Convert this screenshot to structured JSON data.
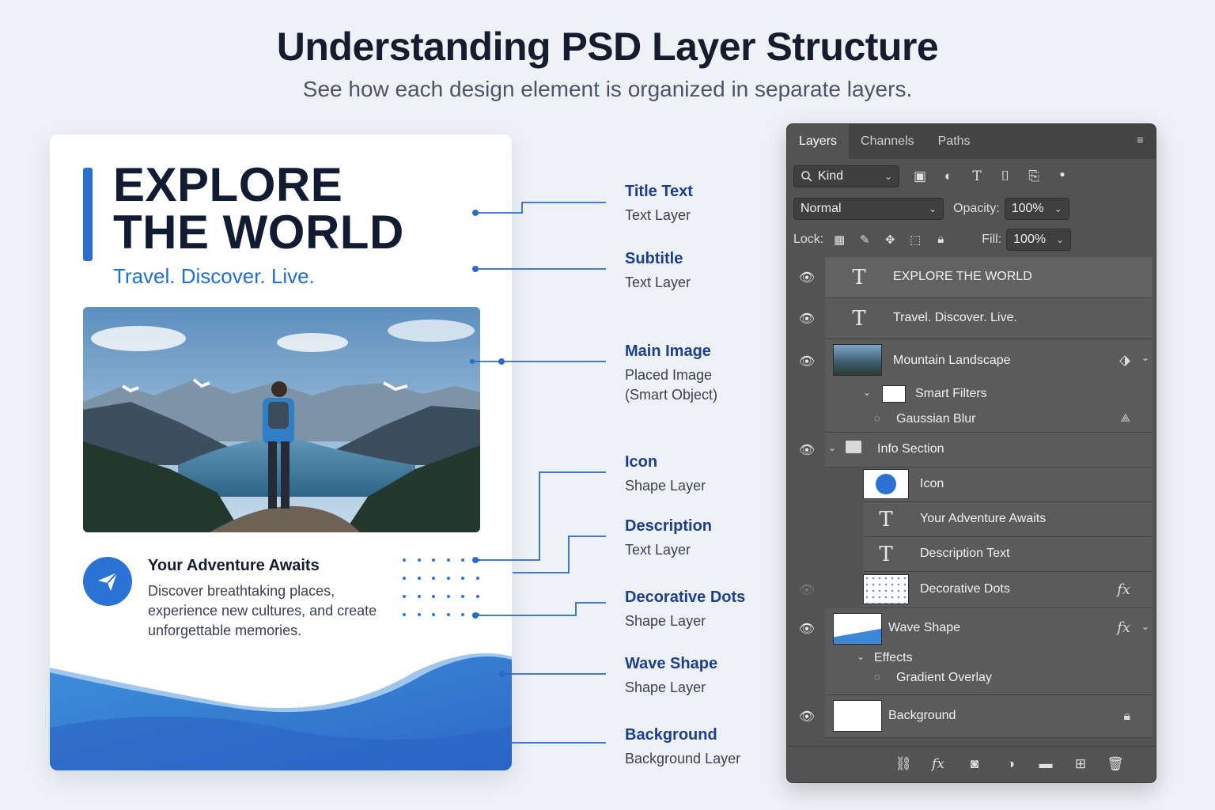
{
  "header": {
    "title": "Understanding PSD Layer Structure",
    "subtitle": "See how each design element is organized in separate layers."
  },
  "poster": {
    "title_line1": "EXPLORE",
    "title_line2": "THE WORLD",
    "subtitle": "Travel. Discover. Live.",
    "info_title": "Your Adventure Awaits",
    "info_desc": "Discover breathtaking places, experience new cultures, and create unforgettable memories."
  },
  "labels": [
    {
      "name": "Title Text",
      "type": "Text Layer"
    },
    {
      "name": "Subtitle",
      "type": "Text Layer"
    },
    {
      "name": "Main Image",
      "type": "Placed Image",
      "type2": "(Smart Object)"
    },
    {
      "name": "Icon",
      "type": "Shape Layer"
    },
    {
      "name": "Description",
      "type": "Text Layer"
    },
    {
      "name": "Decorative Dots",
      "type": "Shape Layer"
    },
    {
      "name": "Wave Shape",
      "type": "Shape Layer"
    },
    {
      "name": "Background",
      "type": "Background Layer"
    }
  ],
  "panel": {
    "tabs": [
      "Layers",
      "Channels",
      "Paths"
    ],
    "filter_label": "Kind",
    "blend_mode": "Normal",
    "opacity_label": "Opacity:",
    "opacity_value": "100%",
    "lock_label": "Lock:",
    "fill_label": "Fill:",
    "fill_value": "100%",
    "layers": {
      "title": "EXPLORE THE WORLD",
      "subtitle": "Travel. Discover. Live.",
      "mountain": "Mountain Landscape",
      "smart_filters": "Smart Filters",
      "gaussian": "Gaussian Blur",
      "info_section": "Info Section",
      "icon": "Icon",
      "adventure": "Your Adventure Awaits",
      "description": "Description Text",
      "dots": "Decorative Dots",
      "wave": "Wave Shape",
      "effects": "Effects",
      "gradient": "Gradient Overlay",
      "background": "Background"
    },
    "icons": {
      "text_glyph": "T",
      "fx_glyph": "fx",
      "eye": "eye-icon",
      "lock": "lock-icon",
      "folder": "folder-icon"
    }
  },
  "colors": {
    "accent_blue": "#2c6fd1",
    "label_blue": "#1d3f8a",
    "panel_bg": "#535353"
  }
}
